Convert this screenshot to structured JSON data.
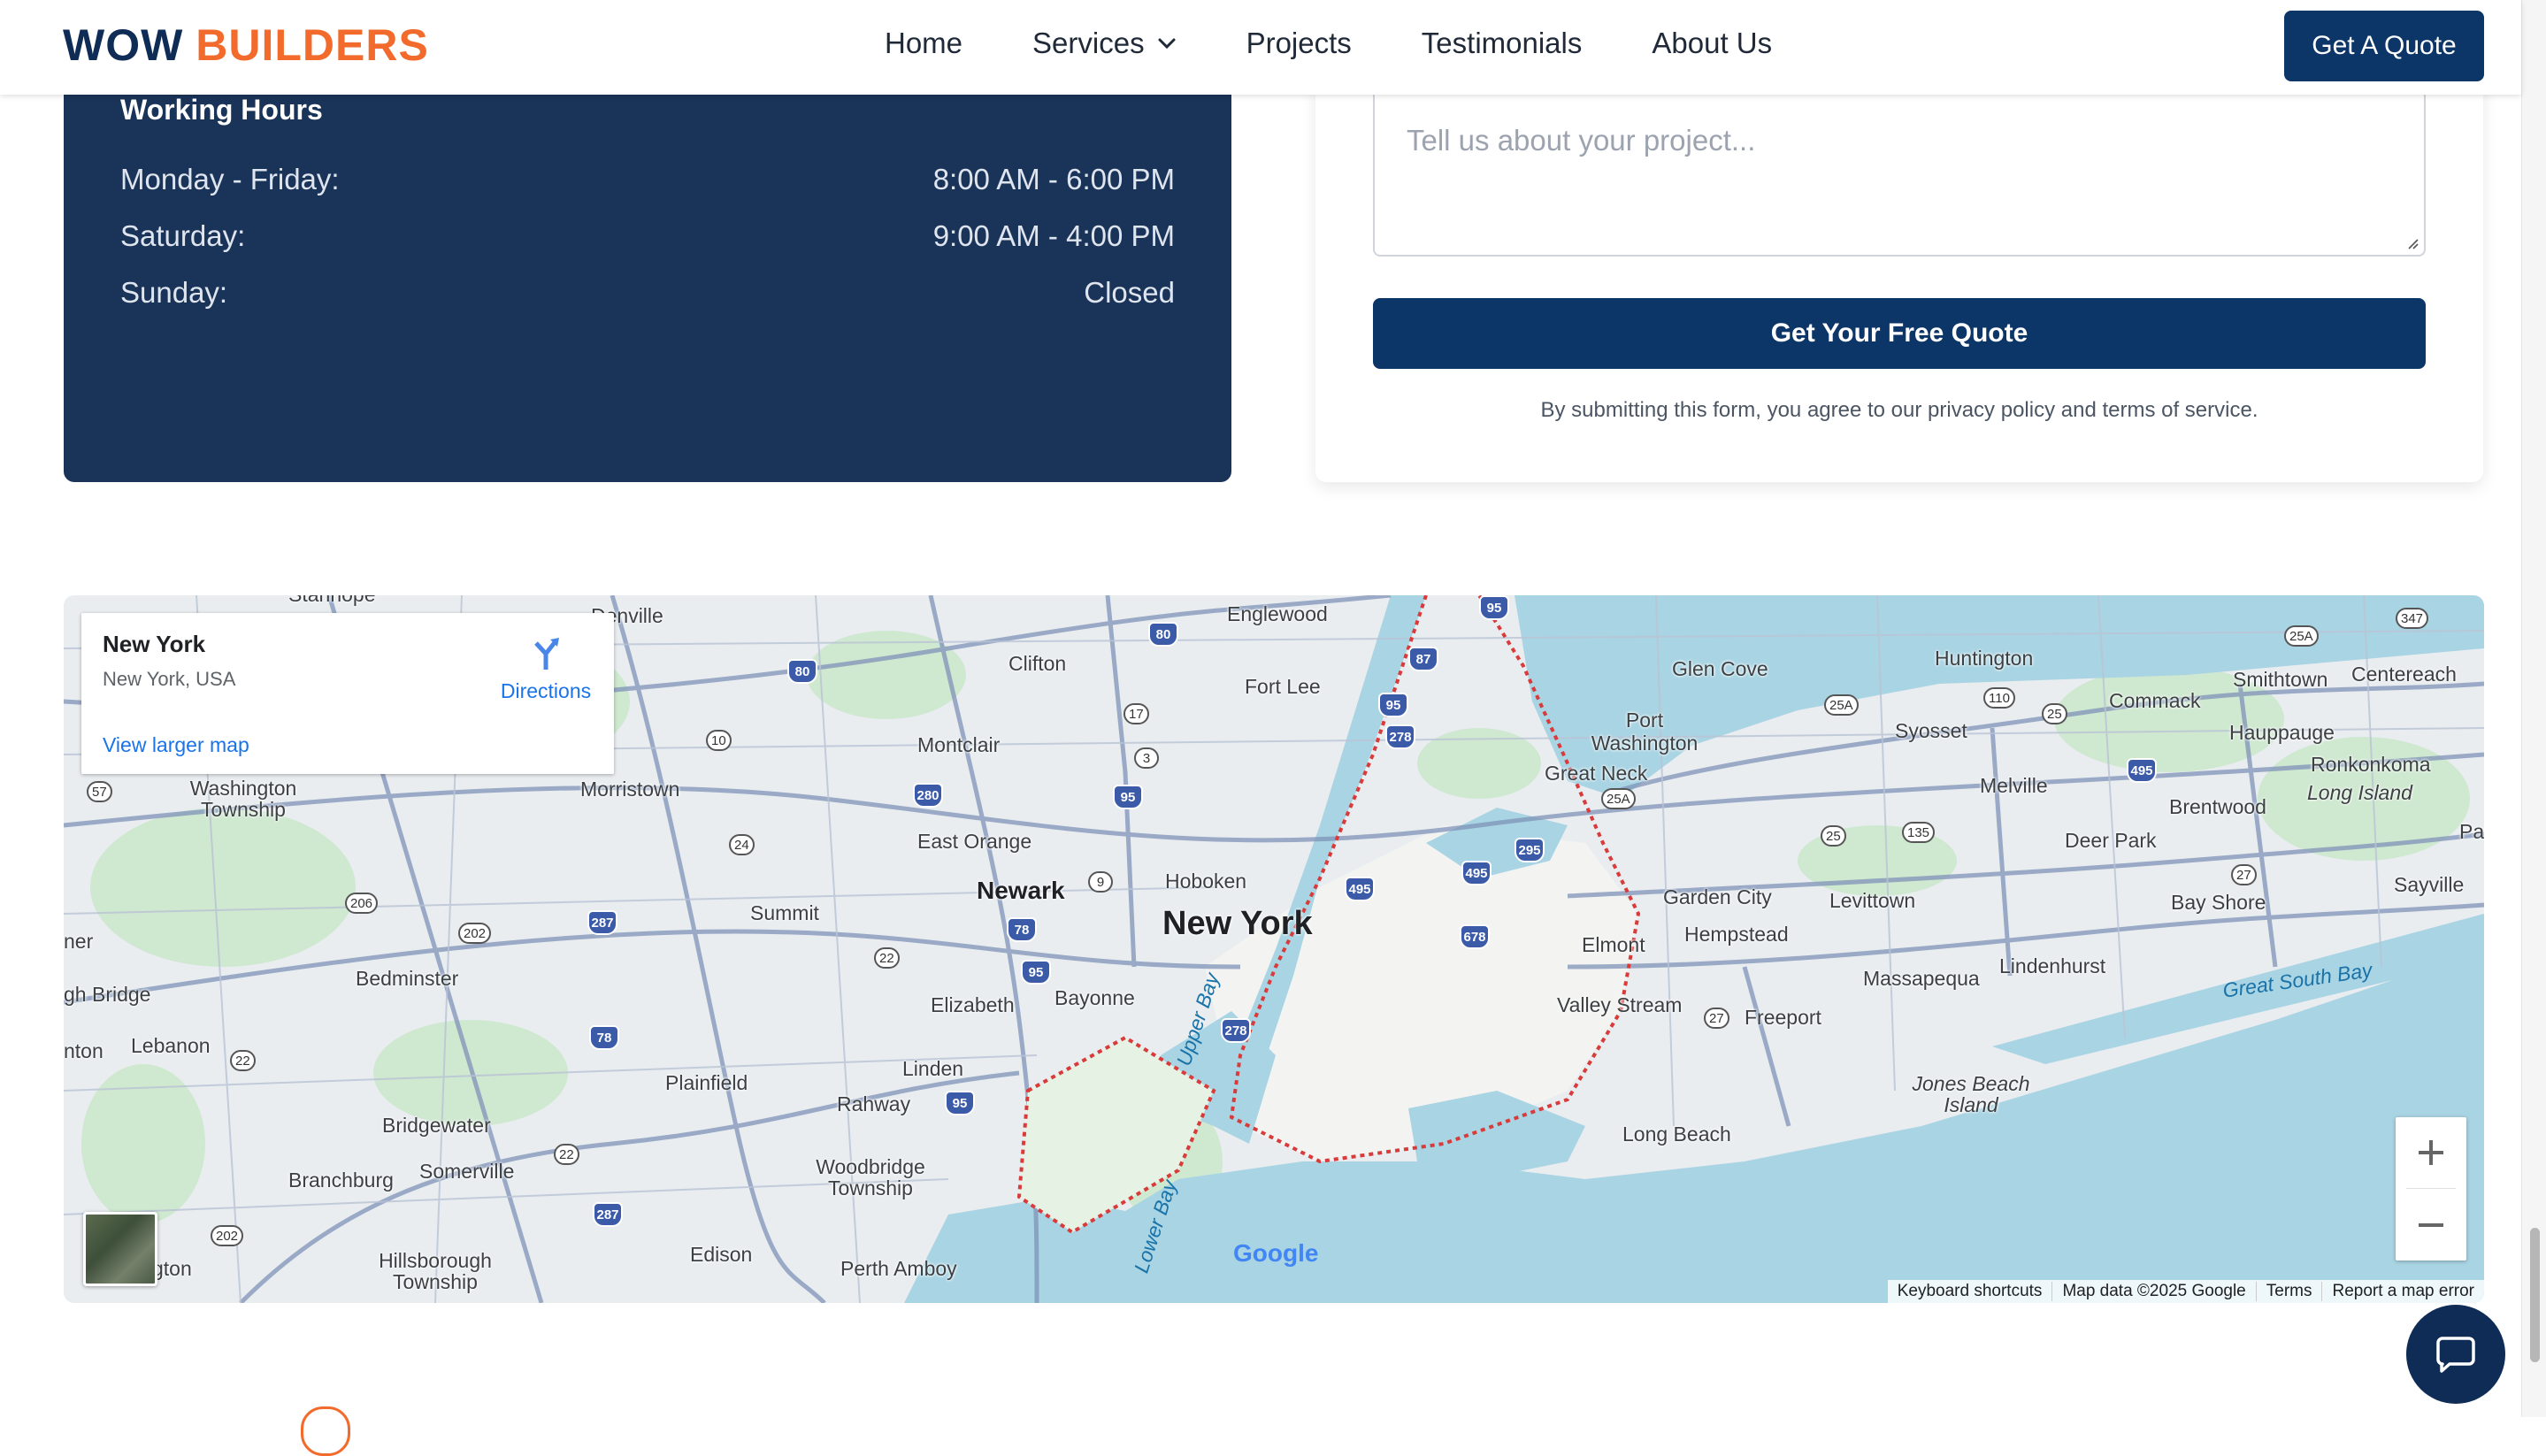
{
  "nav": {
    "logo_part1": "WOW",
    "logo_part2": "BUILDERS",
    "links": [
      "Home",
      "Services",
      "Projects",
      "Testimonials",
      "About Us"
    ],
    "cta": "Get A Quote"
  },
  "hours": {
    "title": "Working Hours",
    "rows": [
      {
        "day": "Monday - Friday:",
        "time": "8:00 AM - 6:00 PM"
      },
      {
        "day": "Saturday:",
        "time": "9:00 AM - 4:00 PM"
      },
      {
        "day": "Sunday:",
        "time": "Closed"
      }
    ]
  },
  "form": {
    "textarea_placeholder": "Tell us about your project...",
    "submit": "Get Your Free Quote",
    "disclaimer": "By submitting this form, you agree to our privacy policy and terms of service."
  },
  "map": {
    "info_title": "New York",
    "info_subtitle": "New York, USA",
    "directions": "Directions",
    "view_larger": "View larger map",
    "google": "Google",
    "attribution": [
      "Keyboard shortcuts",
      "Map data ©2025 Google",
      "Terms",
      "Report a map error"
    ],
    "labels": {
      "new_york": "New York",
      "newark": "Newark",
      "hoboken": "Hoboken",
      "englewood": "Englewood",
      "clifton": "Clifton",
      "fort_lee": "Fort Lee",
      "montclair": "Montclair",
      "east_orange": "East Orange",
      "summit": "Summit",
      "bayonne": "Bayonne",
      "elizabeth": "Elizabeth",
      "linden": "Linden",
      "rahway": "Rahway",
      "plainfield": "Plainfield",
      "bridgewater": "Bridgewater",
      "somerville": "Somerville",
      "branchburg": "Branchburg",
      "bedminster": "Bedminster",
      "lebanon": "Lebanon",
      "morristown": "Morristown",
      "washington_township": "Washington Township",
      "hillsborough": "Hillsborough Township",
      "woodbridge": "Woodbridge Township",
      "edison": "Edison",
      "perth_amboy": "Perth Amboy",
      "glen_cove": "Glen Cove",
      "port_washington": "Port Washington",
      "great_neck": "Great Neck",
      "huntington": "Huntington",
      "syosset": "Syosset",
      "commack": "Commack",
      "smithtown": "Smithtown",
      "centereach": "Centereach",
      "hauppauge": "Hauppauge",
      "ronkonkoma": "Ronkonkoma",
      "long_island": "Long Island",
      "melville": "Melville",
      "brentwood": "Brentwood",
      "deer_park": "Deer Park",
      "sayville": "Sayville",
      "bay_shore": "Bay Shore",
      "garden_city": "Garden City",
      "levittown": "Levittown",
      "hempstead": "Hempstead",
      "elmont": "Elmont",
      "valley_stream": "Valley Stream",
      "freeport": "Freeport",
      "massapequa": "Massapequa",
      "lindenhurst": "Lindenhurst",
      "jones_beach": "Jones Beach Island",
      "long_beach": "Long Beach",
      "great_south_bay": "Great South Bay",
      "upper_bay": "Upper Bay",
      "lower_bay": "Lower Bay",
      "stanhope": "Stanhope",
      "denville": "Denville",
      "ner": "ner",
      "gh_bridge": "gh Bridge",
      "nton": "nton",
      "gton": "gton",
      "pa": "Pa"
    }
  }
}
